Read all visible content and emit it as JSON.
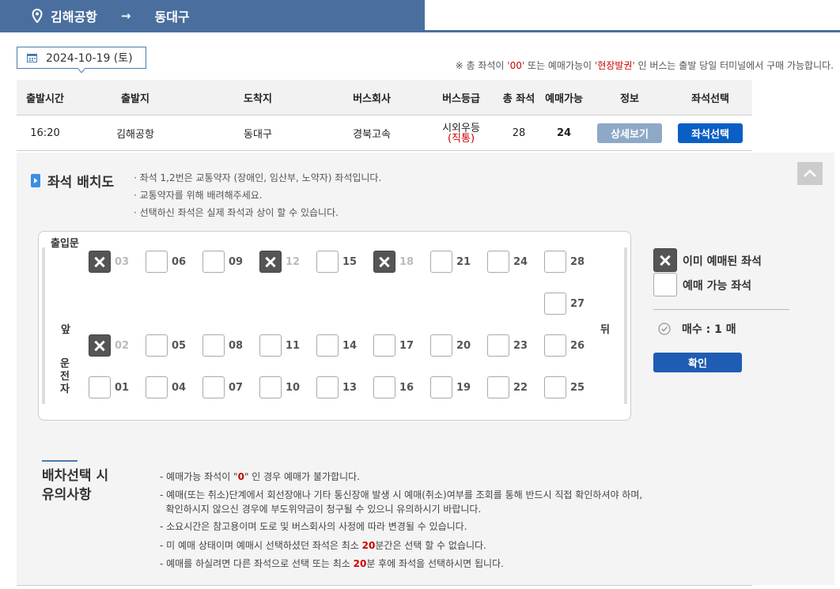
{
  "route": {
    "origin": "김해공항",
    "arrow": "→",
    "destination": "동대구"
  },
  "date": {
    "value": "2024-10-19 (토)"
  },
  "notice": {
    "pre": "※ 총 좌석이 '",
    "zero": "00",
    "mid": "' 또는 예매가능이 '",
    "onsite": "현장발권",
    "post": "' 인 버스는 출발 당일 터미널에서 구매 가능합니다."
  },
  "table": {
    "headers": [
      "출발시간",
      "출발지",
      "도착지",
      "버스회사",
      "버스등급",
      "총 좌석",
      "예매가능",
      "정보",
      "좌석선택"
    ],
    "row": {
      "time": "16:20",
      "from": "김해공항",
      "to": "동대구",
      "company": "경북고속",
      "grade": "시외우등",
      "grade_sub": "(직통)",
      "total": "28",
      "available": "24",
      "detail_btn": "상세보기",
      "select_btn": "좌석선택"
    }
  },
  "seat_section": {
    "title": "좌석 배치도",
    "guides": [
      "· 좌석 1,2번은 교통약자 (장애인, 임산부, 노약자) 좌석입니다.",
      "· 교통약자를 위해 배려해주세요.",
      "· 선택하신 좌석은 실제 좌석과 상이 할 수 있습니다."
    ],
    "labels": {
      "door": "출입문",
      "front": "앞",
      "back": "뒤",
      "driver": "운\n전\n자"
    },
    "seats": [
      {
        "num": "03",
        "taken": true
      },
      {
        "num": "06",
        "taken": false
      },
      {
        "num": "09",
        "taken": false
      },
      {
        "num": "12",
        "taken": true
      },
      {
        "num": "15",
        "taken": false
      },
      {
        "num": "18",
        "taken": true
      },
      {
        "num": "21",
        "taken": false
      },
      {
        "num": "24",
        "taken": false
      },
      {
        "num": "28",
        "taken": false
      },
      {
        "num": "27",
        "taken": false
      },
      {
        "num": "02",
        "taken": true
      },
      {
        "num": "05",
        "taken": false
      },
      {
        "num": "08",
        "taken": false
      },
      {
        "num": "11",
        "taken": false
      },
      {
        "num": "14",
        "taken": false
      },
      {
        "num": "17",
        "taken": false
      },
      {
        "num": "20",
        "taken": false
      },
      {
        "num": "23",
        "taken": false
      },
      {
        "num": "26",
        "taken": false
      },
      {
        "num": "01",
        "taken": false
      },
      {
        "num": "04",
        "taken": false
      },
      {
        "num": "07",
        "taken": false
      },
      {
        "num": "10",
        "taken": false
      },
      {
        "num": "13",
        "taken": false
      },
      {
        "num": "16",
        "taken": false
      },
      {
        "num": "19",
        "taken": false
      },
      {
        "num": "22",
        "taken": false
      },
      {
        "num": "25",
        "taken": false
      }
    ],
    "legend": {
      "taken": "이미 예매된 좌석",
      "available": "예매 가능 좌석"
    },
    "count_label": "매수 : 1 매",
    "confirm_btn": "확인"
  },
  "caution": {
    "title": "배차선택 시\n유의사항",
    "items": [
      {
        "pre": "- 예매가능 좌석이 \"",
        "hl": "0",
        "post": "\" 인 경우 예매가 불가합니다."
      },
      {
        "pre": "- 예매(또는 취소)단계에서 회선장애나 기타 통신장애 발생 시 예매(취소)여부를 조회를 통해 반드시 직접 확인하셔야 하며,",
        "hl": "",
        "post": ""
      },
      {
        "pre": "  확인하시지 않으신 경우에 부도위약금이 청구될 수 있으니 유의하시기 바랍니다.",
        "hl": "",
        "post": ""
      },
      {
        "pre": "- 소요시간은 참고용이며 도로 및 버스회사의 사정에 따라 변경될 수 있습니다.",
        "hl": "",
        "post": ""
      },
      {
        "pre": "- 미 예매 상태이며 예매시 선택하셨던 좌석은 최소 ",
        "hl": "20",
        "post": "분간은 선택 할 수 없습니다."
      },
      {
        "pre": "- 예매를 하실려면 다른 좌석으로 선택 또는 최소 ",
        "hl": "20",
        "post": "분 후에 좌석을 선택하시면 됩니다."
      }
    ]
  }
}
